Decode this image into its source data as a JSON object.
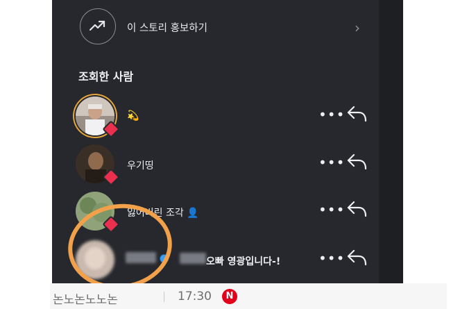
{
  "promote": {
    "label": "이 스토리 홍보하기"
  },
  "viewers_section": {
    "title": "조회한 사람"
  },
  "viewers": [
    {
      "name": "💫"
    },
    {
      "name": "우기띵"
    },
    {
      "name": "잃어버린 조각 👤"
    },
    {
      "name": "오빠 영광입니다-!"
    }
  ],
  "footer": {
    "username": "논노논노노논",
    "time": "17:30",
    "badge": "N"
  },
  "colors": {
    "background": "#26282d",
    "heart": "#ea2f4f",
    "highlight_circle": "#f2a14a",
    "badge": "#e2001a"
  }
}
